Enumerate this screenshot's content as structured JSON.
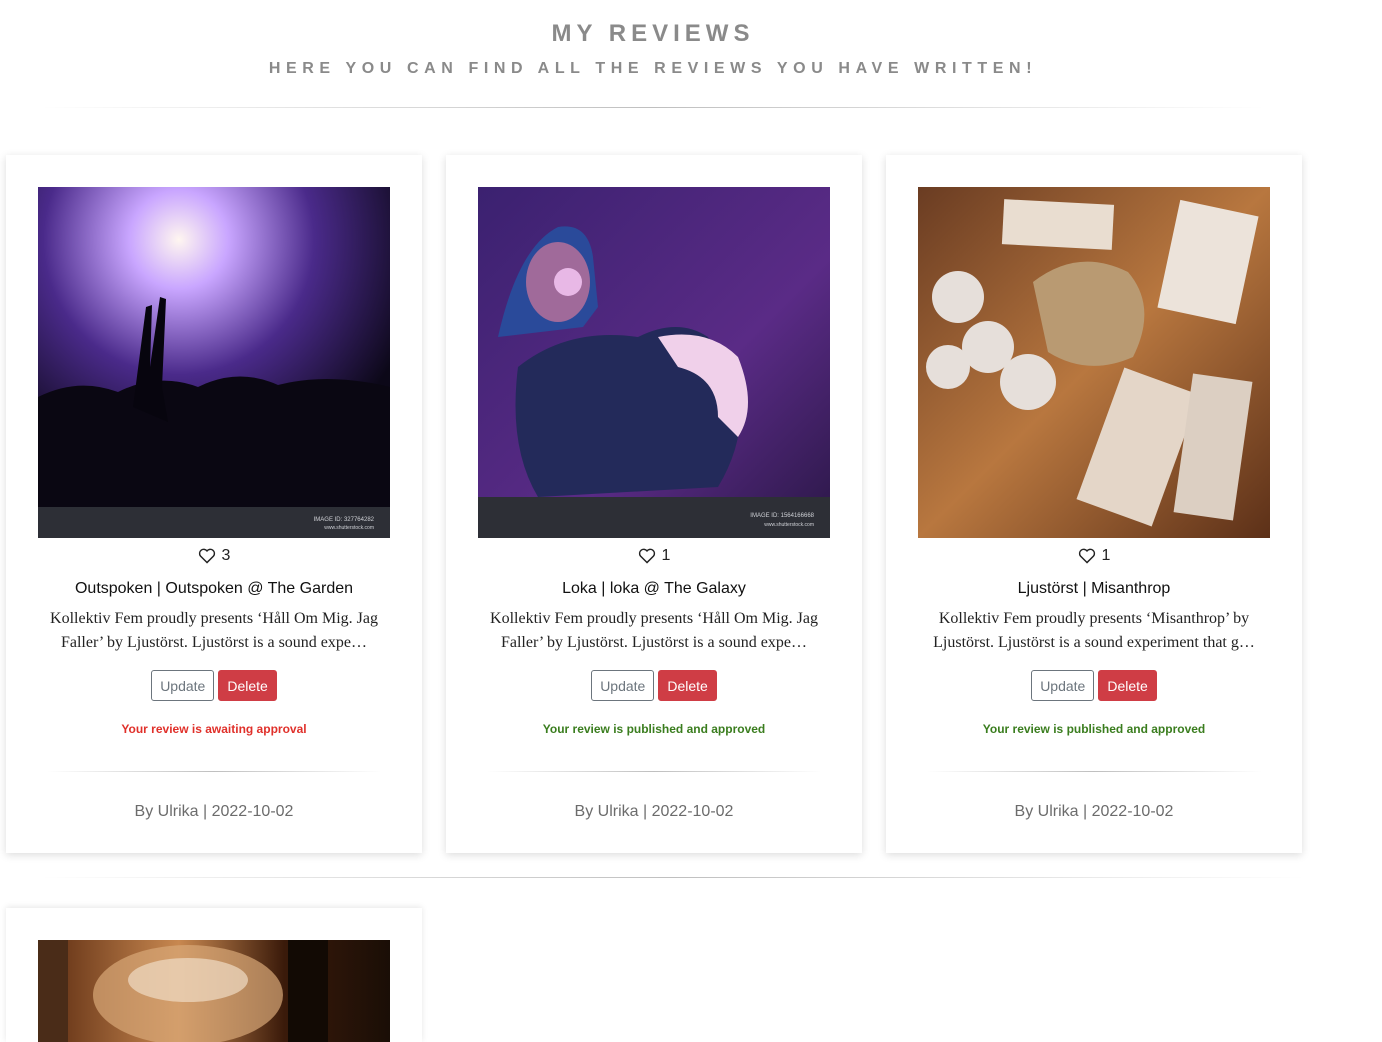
{
  "header": {
    "title": "MY REVIEWS",
    "subtitle": "HERE YOU CAN FIND ALL THE REVIEWS YOU HAVE WRITTEN!"
  },
  "colors": {
    "awaiting": "#e0302a",
    "approved": "#3a7d1e",
    "delete": "#cf3d45"
  },
  "reviews": [
    {
      "image": "concert-crowd-photo",
      "likes": "3",
      "title": "Outspoken | Outspoken @ The Garden",
      "excerpt": "Kollektiv Fem proudly presents ‘Håll Om Mig. Jag Faller’ by Ljustörst. Ljustörst is a sound expe…",
      "update_label": "Update",
      "delete_label": "Delete",
      "status": "Your review is awaiting approval",
      "status_type": "awaiting",
      "byline": "By Ulrika | 2022-10-02"
    },
    {
      "image": "dj-headphones-photo",
      "likes": "1",
      "title": "Loka | loka @ The Galaxy",
      "excerpt": "Kollektiv Fem proudly presents ‘Håll Om Mig. Jag Faller’ by Ljustörst. Ljustörst is a sound expe…",
      "update_label": "Update",
      "delete_label": "Delete",
      "status": "Your review is published and approved",
      "status_type": "approved",
      "byline": "By Ulrika | 2022-10-02"
    },
    {
      "image": "cassette-merch-photo",
      "likes": "1",
      "title": "Ljustörst | Misanthrop",
      "excerpt": "Kollektiv Fem proudly presents ‘Misanthrop’ by Ljustörst. Ljustörst is a sound experiment that g…",
      "update_label": "Update",
      "delete_label": "Delete",
      "status": "Your review is published and approved",
      "status_type": "approved",
      "byline": "By Ulrika | 2022-10-02"
    },
    {
      "image": "amber-glass-photo"
    }
  ]
}
